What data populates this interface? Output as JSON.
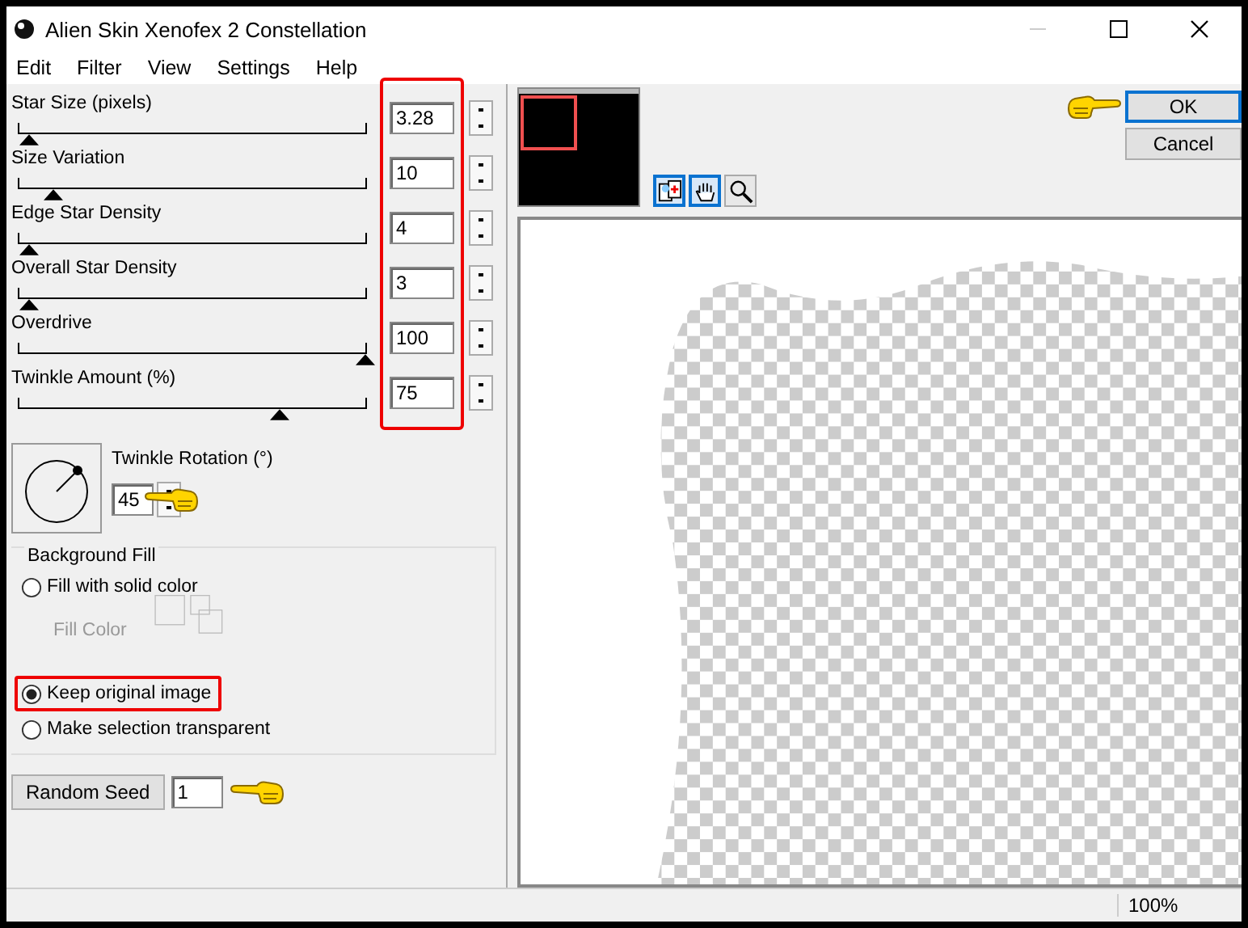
{
  "window": {
    "title": "Alien Skin Xenofex 2 Constellation"
  },
  "menu": [
    "Edit",
    "Filter",
    "View",
    "Settings",
    "Help"
  ],
  "sliders": [
    {
      "label": "Star Size (pixels)",
      "value": "3.28",
      "level": 0.03
    },
    {
      "label": "Size Variation",
      "value": "10",
      "level": 0.1
    },
    {
      "label": "Edge Star Density",
      "value": "4",
      "level": 0.03
    },
    {
      "label": "Overall Star Density",
      "value": "3",
      "level": 0.03
    },
    {
      "label": "Overdrive",
      "value": "100",
      "level": 1
    },
    {
      "label": "Twinkle Amount (%)",
      "value": "75",
      "level": 0.75
    }
  ],
  "rotation": {
    "label": "Twinkle Rotation (°)",
    "value": "45"
  },
  "background_fill": {
    "title": "Background Fill",
    "fill_color": {
      "label": "Fill Color",
      "disabled": true
    },
    "options": [
      {
        "label": "Fill with solid color",
        "selected": false
      },
      {
        "label": "Keep original image",
        "selected": true
      },
      {
        "label": "Make selection transparent",
        "selected": false
      }
    ]
  },
  "random_seed": {
    "button": "Random Seed",
    "value": "1"
  },
  "tools": [
    {
      "kind": "preview",
      "selected": true
    },
    {
      "kind": "hand",
      "selected": true
    },
    {
      "kind": "zoom",
      "selected": false
    }
  ],
  "buttons": [
    "OK",
    "Cancel"
  ],
  "status_bar": {
    "zoom": "100%"
  }
}
